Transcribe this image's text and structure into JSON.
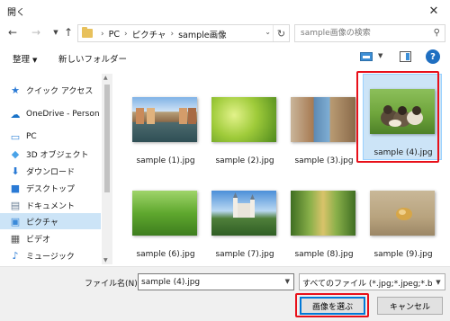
{
  "window": {
    "title": "開く"
  },
  "address": {
    "crumbs": [
      "PC",
      "ピクチャ",
      "sample画像"
    ]
  },
  "search": {
    "placeholder": "sample画像の検索"
  },
  "toolbar": {
    "organize": "整理",
    "new_folder": "新しいフォルダー"
  },
  "sidebar": {
    "items": [
      {
        "label": "クイック アクセス",
        "icon": "star-icon"
      },
      {
        "label": "OneDrive - Person",
        "icon": "cloud-icon"
      },
      {
        "label": "PC",
        "icon": "pc-icon"
      },
      {
        "label": "3D オブジェクト",
        "icon": "cube-icon"
      },
      {
        "label": "ダウンロード",
        "icon": "download-icon"
      },
      {
        "label": "デスクトップ",
        "icon": "desktop-icon"
      },
      {
        "label": "ドキュメント",
        "icon": "document-icon"
      },
      {
        "label": "ピクチャ",
        "icon": "pictures-icon",
        "selected": true
      },
      {
        "label": "ビデオ",
        "icon": "video-icon"
      },
      {
        "label": "ミュージック",
        "icon": "music-icon"
      }
    ]
  },
  "files": [
    {
      "name": "sample (1).jpg"
    },
    {
      "name": "sample (2).jpg"
    },
    {
      "name": "sample (3).jpg"
    },
    {
      "name": "sample (4).jpg",
      "selected": true
    },
    {
      "name": "sample (6).jpg"
    },
    {
      "name": "sample (7).jpg"
    },
    {
      "name": "sample (8).jpg"
    },
    {
      "name": "sample (9).jpg"
    }
  ],
  "footer": {
    "filename_label": "ファイル名(N):",
    "filename_value": "sample (4).jpg",
    "filetype_value": "すべてのファイル (*.jpg;*.jpeg;*.bmp",
    "open_button": "画像を選ぶ",
    "cancel_button": "キャンセル"
  },
  "colors": {
    "selection": "#cce4f7",
    "highlight": "#e8101a",
    "accent": "#0078d7"
  }
}
